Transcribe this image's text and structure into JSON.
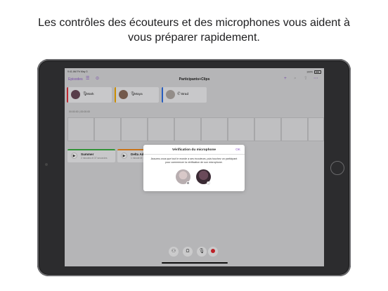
{
  "headline": {
    "line1": "Les contrôles des écouteurs et des microphones vous aident à",
    "line2": "vous préparer rapidement."
  },
  "status_bar": {
    "time": "9:41 AM  Fri May 3",
    "battery": "100%"
  },
  "nav": {
    "back_label": "Episodes",
    "title": "Participants+Clips",
    "icons": [
      "list-icon",
      "history-icon",
      "plus-icon",
      "search-icon",
      "share-icon",
      "more-icon"
    ]
  },
  "participants": [
    {
      "name": "Mark",
      "accent": "#e0303a",
      "input_icon": "microphone-icon"
    },
    {
      "name": "Maya",
      "accent": "#f2a900",
      "input_icon": "microphone-icon"
    },
    {
      "name": "Brad",
      "accent": "#2f6fe4",
      "input_icon": "phone-icon"
    }
  ],
  "timeline": {
    "timecode": "00:00:00 | 00:00:00"
  },
  "clips": [
    {
      "title": "Summer",
      "subtitle": "2 minutes et 37 secondes",
      "accent": "#3cb043"
    },
    {
      "title": "Delta Ad 1",
      "subtitle": "1 minute et 14 secondes",
      "accent": "#f08a1c"
    }
  ],
  "modal": {
    "title": "Vérification du microphone",
    "ok_label": "OK",
    "body": "Assurez-vous que tout le monde a ses écouteurs, puis touchez un participant pour commencer la vérification de son microphone."
  },
  "toolbar": {
    "buttons": [
      "add-participant-icon",
      "headphones-icon",
      "microphone-icon",
      "record-icon"
    ]
  },
  "colors": {
    "accent": "#8f5ac9",
    "record": "#e0272f"
  }
}
